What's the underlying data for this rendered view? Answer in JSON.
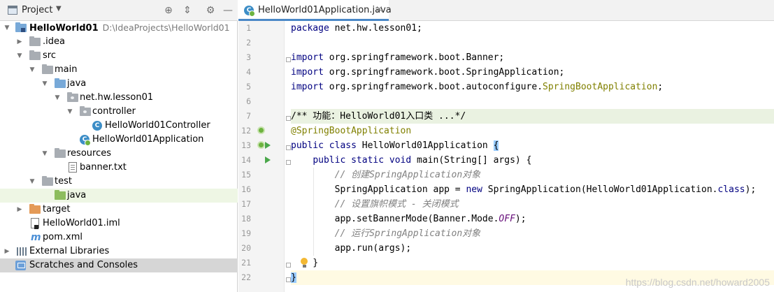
{
  "project_panel": {
    "title": "Project",
    "dropdown_icon": "triangle-down-icon",
    "tools": [
      "target-icon",
      "collapse-icon",
      "gear-icon",
      "minimize-icon"
    ],
    "tree": [
      {
        "label": "HelloWorld01",
        "path": "D:\\IdeaProjects\\HelloWorld01"
      },
      {
        "label": ".idea"
      },
      {
        "label": "src"
      },
      {
        "label": "main"
      },
      {
        "label": "java"
      },
      {
        "label": "net.hw.lesson01"
      },
      {
        "label": "controller"
      },
      {
        "label": "HelloWorld01Controller"
      },
      {
        "label": "HelloWorld01Application"
      },
      {
        "label": "resources"
      },
      {
        "label": "banner.txt"
      },
      {
        "label": "test"
      },
      {
        "label": "java"
      },
      {
        "label": "target"
      },
      {
        "label": "HelloWorld01.iml"
      },
      {
        "label": "pom.xml"
      },
      {
        "label": "External Libraries"
      },
      {
        "label": "Scratches and Consoles"
      }
    ]
  },
  "editor": {
    "tab": {
      "label": "HelloWorld01Application.java",
      "close": "×"
    },
    "line_numbers": [
      "1",
      "2",
      "3",
      "4",
      "5",
      "6",
      "7",
      "12",
      "13",
      "14",
      "15",
      "16",
      "17",
      "18",
      "19",
      "20",
      "21",
      "22"
    ],
    "lines": {
      "l1_kw": "package",
      "l1_rest": " net.hw.lesson01;",
      "l3_kw": "import",
      "l3_rest": " org.springframework.boot.Banner;",
      "l4_kw": "import",
      "l4_rest": " org.springframework.boot.SpringApplication;",
      "l5_kw": "import",
      "l5_rest": " org.springframework.boot.autoconfigure.",
      "l5_ann": "SpringBootApplication",
      "l5_end": ";",
      "l7": "/** 功能：HelloWorld01入口类 ...*/",
      "l12": "@SpringBootApplication",
      "l13_kw": "public class",
      "l13_rest": " HelloWorld01Application ",
      "l13_brace": "{",
      "l14_indent": "    ",
      "l14_kw": "public static void",
      "l14_rest": " main(String[] args) {",
      "l15": "        // 创建SpringApplication对象",
      "l16_a": "        SpringApplication app = ",
      "l16_kw": "new",
      "l16_b": " SpringApplication(HelloWorld01Application.",
      "l16_kw2": "class",
      "l16_c": ");",
      "l17": "        // 设置旗帜模式 - 关闭模式",
      "l18_a": "        app.setBannerMode(Banner.Mode.",
      "l18_const": "OFF",
      "l18_b": ");",
      "l19": "        // 运行SpringApplication对象",
      "l20": "        app.run(args);",
      "l21": "    }",
      "l22": "}"
    }
  },
  "watermark": "https://blog.csdn.net/howard2005",
  "colors": {
    "keyword": "#000080",
    "annotation": "#808000",
    "comment": "#808080",
    "constant": "#660e7a",
    "tab_underline": "#4a88c7"
  }
}
